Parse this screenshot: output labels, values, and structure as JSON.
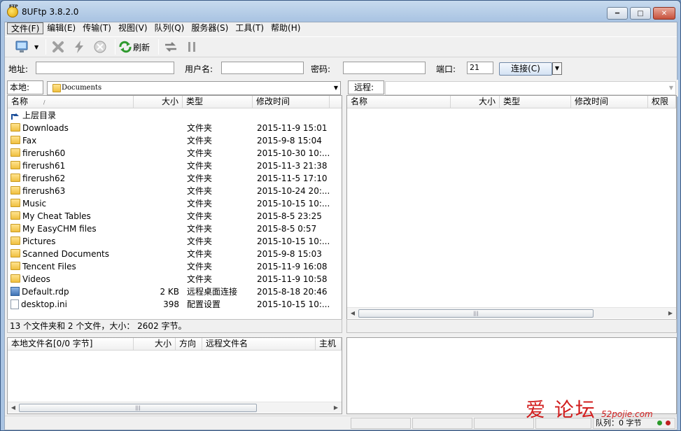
{
  "window": {
    "title": "8UFtp 3.8.2.0",
    "icon_label": "FTP"
  },
  "menu": [
    "文件(F)",
    "编辑(E)",
    "传输(T)",
    "视图(V)",
    "队列(Q)",
    "服务器(S)",
    "工具(T)",
    "帮助(H)"
  ],
  "toolbar": {
    "refresh_label": "刷新"
  },
  "connect": {
    "address_label": "地址:",
    "address_value": "",
    "user_label": "用户名:",
    "user_value": "",
    "password_label": "密码:",
    "password_value": "",
    "port_label": "端口:",
    "port_value": "21",
    "connect_label": "连接(C)"
  },
  "local": {
    "label": "本地:",
    "path": "Documents",
    "columns": [
      "名称",
      "大小",
      "类型",
      "修改时间"
    ],
    "rows": [
      {
        "icon": "up-folder-icon",
        "name": "上层目录",
        "size": "",
        "type": "",
        "modified": ""
      },
      {
        "icon": "folder-icon",
        "name": "Downloads",
        "size": "",
        "type": "文件夹",
        "modified": "2015-11-9 15:01"
      },
      {
        "icon": "folder-icon",
        "name": "Fax",
        "size": "",
        "type": "文件夹",
        "modified": "2015-9-8 15:04"
      },
      {
        "icon": "folder-icon",
        "name": "firerush60",
        "size": "",
        "type": "文件夹",
        "modified": "2015-10-30 10:..."
      },
      {
        "icon": "folder-icon",
        "name": "firerush61",
        "size": "",
        "type": "文件夹",
        "modified": "2015-11-3 21:38"
      },
      {
        "icon": "folder-icon",
        "name": "firerush62",
        "size": "",
        "type": "文件夹",
        "modified": "2015-11-5 17:10"
      },
      {
        "icon": "folder-icon",
        "name": "firerush63",
        "size": "",
        "type": "文件夹",
        "modified": "2015-10-24 20:..."
      },
      {
        "icon": "folder-icon",
        "name": "Music",
        "size": "",
        "type": "文件夹",
        "modified": "2015-10-15 10:..."
      },
      {
        "icon": "folder-icon",
        "name": "My Cheat Tables",
        "size": "",
        "type": "文件夹",
        "modified": "2015-8-5 23:25"
      },
      {
        "icon": "folder-icon",
        "name": "My EasyCHM files",
        "size": "",
        "type": "文件夹",
        "modified": "2015-8-5 0:57"
      },
      {
        "icon": "folder-icon",
        "name": "Pictures",
        "size": "",
        "type": "文件夹",
        "modified": "2015-10-15 10:..."
      },
      {
        "icon": "folder-icon",
        "name": "Scanned Documents",
        "size": "",
        "type": "文件夹",
        "modified": "2015-9-8 15:03"
      },
      {
        "icon": "folder-icon",
        "name": "Tencent Files",
        "size": "",
        "type": "文件夹",
        "modified": "2015-11-9 16:08"
      },
      {
        "icon": "folder-icon",
        "name": "Videos",
        "size": "",
        "type": "文件夹",
        "modified": "2015-11-9 10:58"
      },
      {
        "icon": "rdp-file-icon",
        "name": "Default.rdp",
        "size": "2 KB",
        "type": "远程桌面连接",
        "modified": "2015-8-18 20:46"
      },
      {
        "icon": "ini-file-icon",
        "name": "desktop.ini",
        "size": "398",
        "type": "配置设置",
        "modified": "2015-10-15 10:..."
      }
    ],
    "status": "13 个文件夹和 2 个文件，大小： 2602 字节。"
  },
  "remote": {
    "label": "远程:",
    "path": "",
    "columns": [
      "名称",
      "大小",
      "类型",
      "修改时间",
      "权限"
    ]
  },
  "queue": {
    "columns": [
      "本地文件名[0/0 字节]",
      "大小",
      "方向",
      "远程文件名",
      "主机"
    ]
  },
  "statusbar": {
    "queue_text": "队列：0 字节"
  },
  "watermark": {
    "text": "爱  论坛",
    "sub": "52pojie.com"
  }
}
